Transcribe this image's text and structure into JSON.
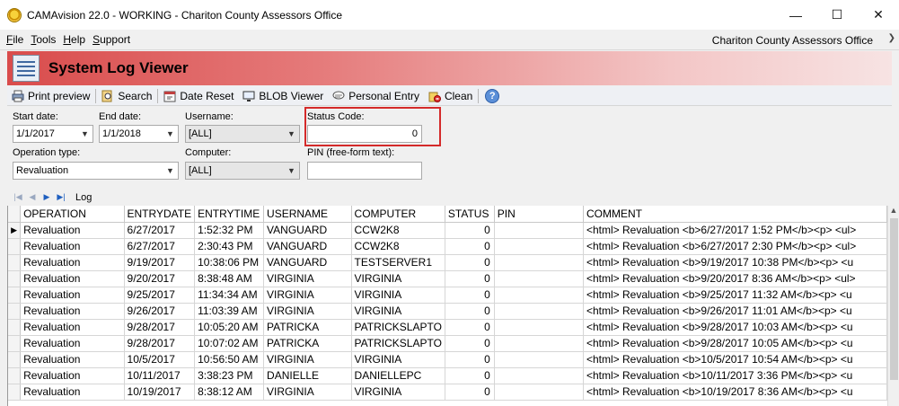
{
  "window": {
    "title": "CAMAvision 22.0 - WORKING - Chariton County Assessors Office",
    "controls": {
      "minimize": "—",
      "maximize": "☐",
      "close": "✕"
    }
  },
  "menu": {
    "items": [
      {
        "key": "F",
        "rest": "ile"
      },
      {
        "key": "T",
        "rest": "ools"
      },
      {
        "key": "H",
        "rest": "elp"
      },
      {
        "key": "S",
        "rest": "upport"
      }
    ],
    "office": "Chariton County Assessors Office"
  },
  "header": {
    "title": "System Log Viewer",
    "color": "#d94c4c"
  },
  "toolbar": {
    "print_preview": "Print preview",
    "search": "Search",
    "date_reset": "Date Reset",
    "blob_viewer": "BLOB Viewer",
    "personal_entry": "Personal Entry",
    "clean": "Clean",
    "help": "?"
  },
  "filters": {
    "start_date": {
      "label": "Start date:",
      "value": "1/1/2017"
    },
    "end_date": {
      "label": "End date:",
      "value": "1/1/2018"
    },
    "username": {
      "label": "Username:",
      "value": "[ALL]"
    },
    "status_code": {
      "label": "Status Code:",
      "value": "0"
    },
    "operation_type": {
      "label": "Operation type:",
      "value": "Revaluation"
    },
    "computer": {
      "label": "Computer:",
      "value": "[ALL]"
    },
    "pin": {
      "label": "PIN (free-form text):",
      "value": ""
    },
    "highlight_color": "#d42a2a"
  },
  "navigator": {
    "label": "Log"
  },
  "grid": {
    "columns": [
      "OPERATION",
      "ENTRYDATE",
      "ENTRYTIME",
      "USERNAME",
      "COMPUTER",
      "STATUS",
      "PIN",
      "COMMENT"
    ],
    "rows": [
      [
        "Revaluation",
        "6/27/2017",
        "1:52:32 PM",
        "VANGUARD",
        "CCW2K8",
        "0",
        "",
        "<html> Revaluation <b>6/27/2017 1:52 PM</b><p> <ul>"
      ],
      [
        "Revaluation",
        "6/27/2017",
        "2:30:43 PM",
        "VANGUARD",
        "CCW2K8",
        "0",
        "",
        "<html> Revaluation <b>6/27/2017 2:30 PM</b><p> <ul>"
      ],
      [
        "Revaluation",
        "9/19/2017",
        "10:38:06 PM",
        "VANGUARD",
        "TESTSERVER1",
        "0",
        "",
        "<html> Revaluation <b>9/19/2017 10:38 PM</b><p> <u"
      ],
      [
        "Revaluation",
        "9/20/2017",
        "8:38:48 AM",
        "VIRGINIA",
        "VIRGINIA",
        "0",
        "",
        "<html> Revaluation <b>9/20/2017 8:36 AM</b><p> <ul>"
      ],
      [
        "Revaluation",
        "9/25/2017",
        "11:34:34 AM",
        "VIRGINIA",
        "VIRGINIA",
        "0",
        "",
        "<html> Revaluation <b>9/25/2017 11:32 AM</b><p> <u"
      ],
      [
        "Revaluation",
        "9/26/2017",
        "11:03:39 AM",
        "VIRGINIA",
        "VIRGINIA",
        "0",
        "",
        "<html> Revaluation <b>9/26/2017 11:01 AM</b><p> <u"
      ],
      [
        "Revaluation",
        "9/28/2017",
        "10:05:20 AM",
        "PATRICKA",
        "PATRICKSLAPTO",
        "0",
        "",
        "<html> Revaluation <b>9/28/2017 10:03 AM</b><p> <u"
      ],
      [
        "Revaluation",
        "9/28/2017",
        "10:07:02 AM",
        "PATRICKA",
        "PATRICKSLAPTO",
        "0",
        "",
        "<html> Revaluation <b>9/28/2017 10:05 AM</b><p> <u"
      ],
      [
        "Revaluation",
        "10/5/2017",
        "10:56:50 AM",
        "VIRGINIA",
        "VIRGINIA",
        "0",
        "",
        "<html> Revaluation <b>10/5/2017 10:54 AM</b><p> <u"
      ],
      [
        "Revaluation",
        "10/11/2017",
        "3:38:23 PM",
        "DANIELLE",
        "DANIELLEPC",
        "0",
        "",
        "<html> Revaluation <b>10/11/2017 3:36 PM</b><p> <u"
      ],
      [
        "Revaluation",
        "10/19/2017",
        "8:38:12 AM",
        "VIRGINIA",
        "VIRGINIA",
        "0",
        "",
        "<html> Revaluation <b>10/19/2017 8:36 AM</b><p> <u"
      ]
    ],
    "current_row_marker": "▶"
  }
}
